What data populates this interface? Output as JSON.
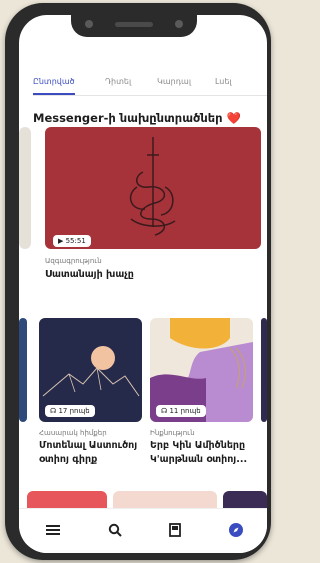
{
  "tabs": [
    {
      "label": "Ընտրված"
    },
    {
      "label": "Դիտել"
    },
    {
      "label": "Կարդալ"
    },
    {
      "label": "Լսել"
    }
  ],
  "section_title": "Messenger-ի նախընտրածներ ❤️",
  "cards": [
    {
      "duration": "▶ 55:51",
      "category": "Ազգագրություն",
      "title": "Սատանայի խաչը"
    },
    {
      "duration": "☊ 17 րոպե",
      "category": "Հասարակ հիմքեր",
      "title": "Մոտենալ Աստուծոյ օտիոյ գիրք"
    },
    {
      "duration": "☊ 11 րոպե",
      "category": "Ինքնություն",
      "title": "Երբ Կին Ամիծները Կ'արթնան օտիոյ..."
    }
  ],
  "colors": {
    "accent": "#3b4cc0",
    "hero_bg": "#a7333a",
    "card_dark": "#262a4a"
  },
  "nav": {
    "icons": [
      "menu-icon",
      "search-icon",
      "book-icon",
      "compass-icon"
    ],
    "active": "compass-icon"
  }
}
